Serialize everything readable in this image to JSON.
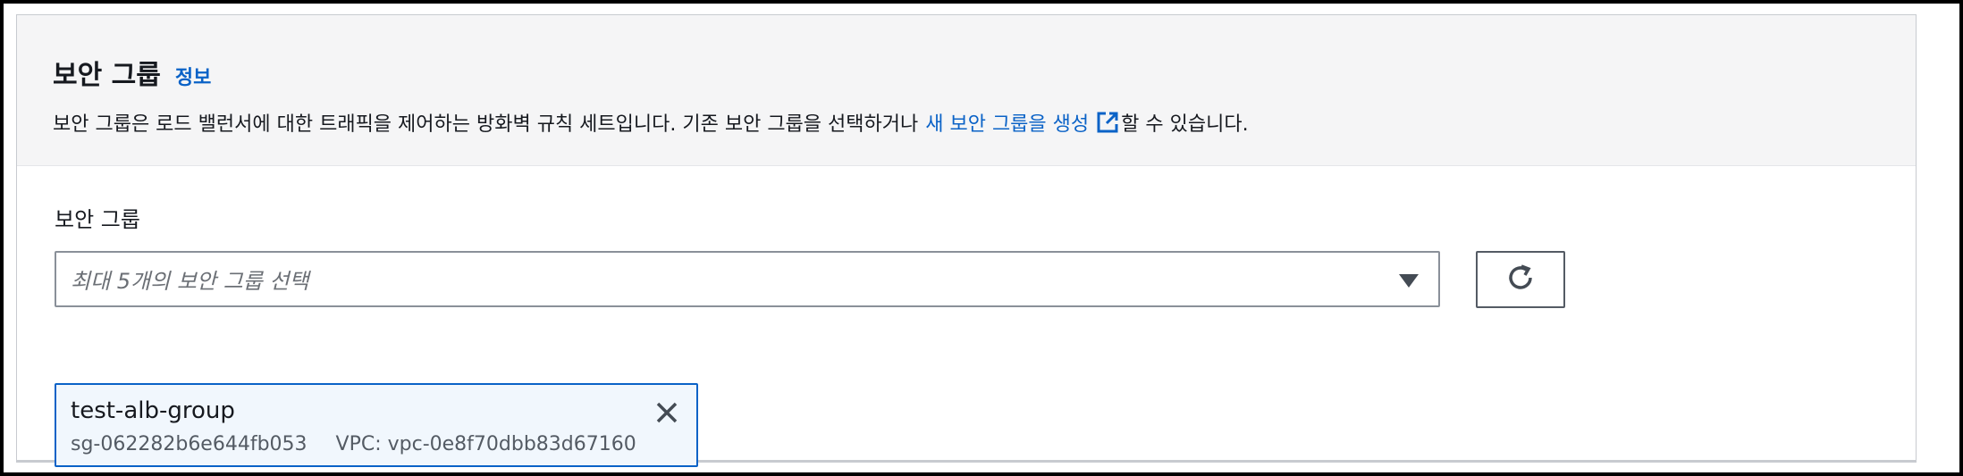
{
  "section": {
    "title": "보안 그룹",
    "info_link": "정보",
    "description_prefix": "보안 그룹은 로드 밸런서에 대한 트래픽을 제어하는 방화벽 규칙 세트입니다. 기존 보안 그룹을 선택하거나",
    "description_link": "새 보안 그룹을 생성",
    "description_suffix": "할 수 있습니다.",
    "external_icon": "external-link-icon"
  },
  "field": {
    "label": "보안 그룹",
    "placeholder": "최대 5개의 보안 그룹 선택",
    "dropdown_icon": "caret-down-icon",
    "refresh_icon": "refresh-icon"
  },
  "selected_groups": [
    {
      "name": "test-alb-group",
      "id": "sg-062282b6e644fb053",
      "vpc": "VPC: vpc-0e8f70dbb83d67160",
      "remove_icon": "close-icon"
    }
  ],
  "colors": {
    "link": "#0a62c7",
    "header_bg": "#f5f5f6",
    "token_bg": "#f1f7fd",
    "token_border": "#0a62c7"
  }
}
